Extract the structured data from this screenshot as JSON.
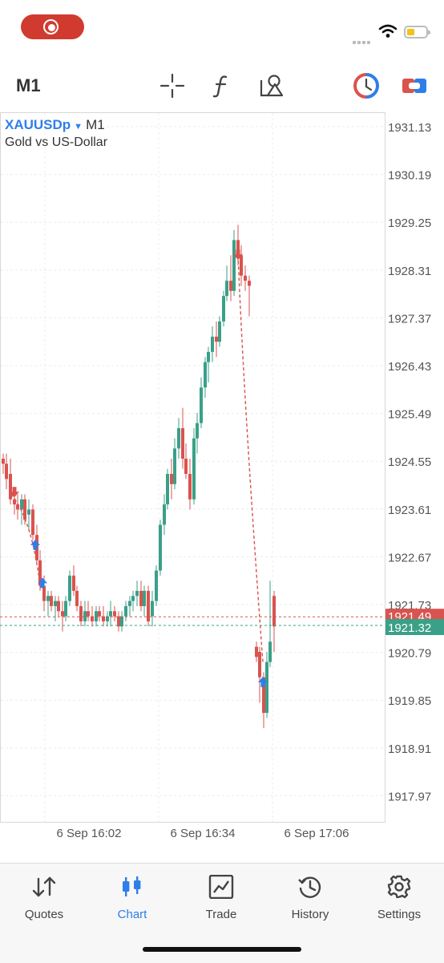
{
  "toolbar": {
    "timeframe": "M1",
    "icons": [
      "crosshair-icon",
      "indicators-icon",
      "objects-icon",
      "one-click-trading-icon",
      "trade-panel-icon"
    ]
  },
  "symbol": {
    "name": "XAUUSDp",
    "timeframe": "M1",
    "description": "Gold vs US-Dollar"
  },
  "price_axis": {
    "labels": [
      "1931.13",
      "1930.19",
      "1929.25",
      "1928.31",
      "1927.37",
      "1926.43",
      "1925.49",
      "1924.55",
      "1923.61",
      "1922.67",
      "1921.73",
      "1920.79",
      "1919.85",
      "1918.91",
      "1917.97"
    ],
    "bid_label": "1921.32",
    "ask_label": "1921.49",
    "bid_color": "#3aa088",
    "ask_color": "#d9534f"
  },
  "time_axis": {
    "labels": [
      "6 Sep 16:02",
      "6 Sep 16:34",
      "6 Sep 17:06"
    ]
  },
  "colors": {
    "bull": "#3aa088",
    "bear": "#d9534f",
    "accent": "#2f7ee8"
  },
  "nav": {
    "items": [
      {
        "label": "Quotes",
        "icon": "quotes-icon",
        "active": false
      },
      {
        "label": "Chart",
        "icon": "chart-icon",
        "active": true
      },
      {
        "label": "Trade",
        "icon": "trade-icon",
        "active": false
      },
      {
        "label": "History",
        "icon": "history-icon",
        "active": false
      },
      {
        "label": "Settings",
        "icon": "settings-icon",
        "active": false
      }
    ]
  }
}
